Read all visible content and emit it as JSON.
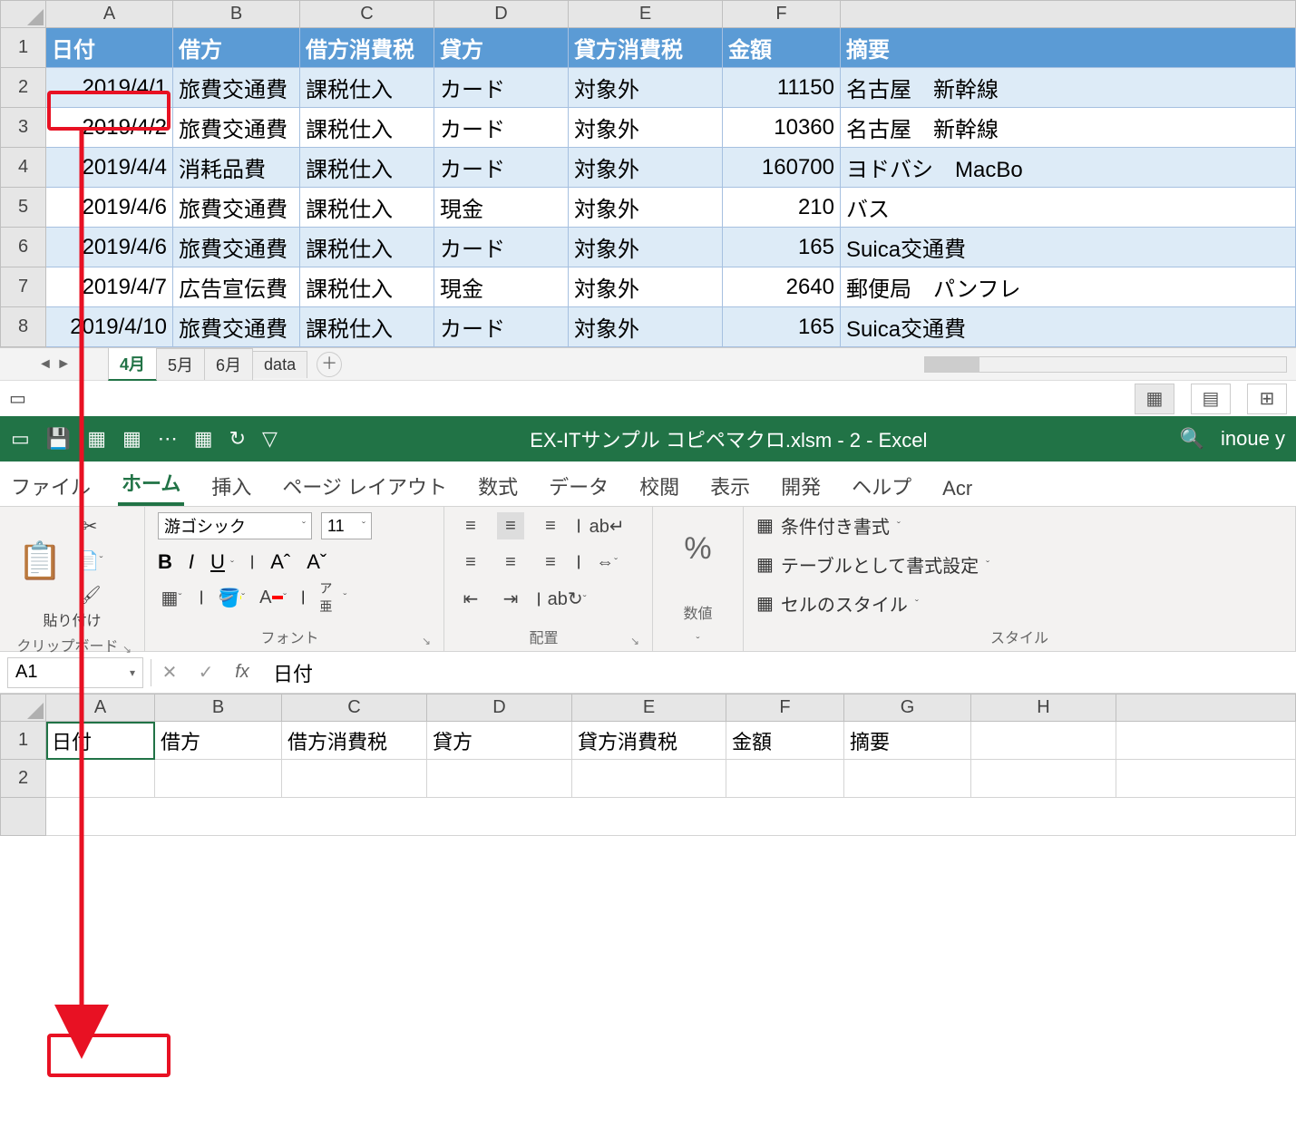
{
  "top_sheet": {
    "columns": [
      "A",
      "B",
      "C",
      "D",
      "E",
      "F",
      ""
    ],
    "headers": [
      "日付",
      "借方",
      "借方消費税",
      "貸方",
      "貸方消費税",
      "金額",
      "摘要"
    ],
    "rows": [
      {
        "n": 2,
        "date": "2019/4/1",
        "debit": "旅費交通費",
        "dtax": "課税仕入",
        "credit": "カード",
        "ctax": "対象外",
        "amount": "11150",
        "desc": "名古屋　新幹線"
      },
      {
        "n": 3,
        "date": "2019/4/2",
        "debit": "旅費交通費",
        "dtax": "課税仕入",
        "credit": "カード",
        "ctax": "対象外",
        "amount": "10360",
        "desc": "名古屋　新幹線"
      },
      {
        "n": 4,
        "date": "2019/4/4",
        "debit": "消耗品費",
        "dtax": "課税仕入",
        "credit": "カード",
        "ctax": "対象外",
        "amount": "160700",
        "desc": "ヨドバシ　MacBo"
      },
      {
        "n": 5,
        "date": "2019/4/6",
        "debit": "旅費交通費",
        "dtax": "課税仕入",
        "credit": "現金",
        "ctax": "対象外",
        "amount": "210",
        "desc": "バス"
      },
      {
        "n": 6,
        "date": "2019/4/6",
        "debit": "旅費交通費",
        "dtax": "課税仕入",
        "credit": "カード",
        "ctax": "対象外",
        "amount": "165",
        "desc": "Suica交通費"
      },
      {
        "n": 7,
        "date": "2019/4/7",
        "debit": "広告宣伝費",
        "dtax": "課税仕入",
        "credit": "現金",
        "ctax": "対象外",
        "amount": "2640",
        "desc": "郵便局　パンフレ"
      },
      {
        "n": 8,
        "date": "2019/4/10",
        "debit": "旅費交通費",
        "dtax": "課税仕入",
        "credit": "カード",
        "ctax": "対象外",
        "amount": "165",
        "desc": "Suica交通費"
      }
    ],
    "tabs": [
      "4月",
      "5月",
      "6月",
      "data"
    ]
  },
  "titlebar": {
    "title": "EX-ITサンプル コピペマクロ.xlsm - 2 - Excel",
    "user": "inoue y"
  },
  "ribbon": {
    "tabs": [
      "ファイル",
      "ホーム",
      "挿入",
      "ページ レイアウト",
      "数式",
      "データ",
      "校閲",
      "表示",
      "開発",
      "ヘルプ",
      "Acr"
    ],
    "clipboard": {
      "paste": "貼り付け",
      "label": "クリップボード"
    },
    "font": {
      "name": "游ゴシック",
      "size": "11",
      "bold": "B",
      "italic": "I",
      "underline": "U",
      "grow": "A",
      "shrink": "A",
      "ruby": "ア亜",
      "label": "フォント"
    },
    "align": {
      "wrap": "ab↵",
      "label": "配置"
    },
    "number": {
      "pct": "%",
      "label": "数値"
    },
    "styles": {
      "cond": "条件付き書式",
      "table": "テーブルとして書式設定",
      "cell": "セルのスタイル",
      "label": "スタイル"
    }
  },
  "formula_bar": {
    "ref": "A1",
    "value": "日付"
  },
  "bottom_sheet": {
    "columns": [
      "A",
      "B",
      "C",
      "D",
      "E",
      "F",
      "G",
      "H",
      ""
    ],
    "row1": [
      "日付",
      "借方",
      "借方消費税",
      "貸方",
      "貸方消費税",
      "金額",
      "摘要",
      "",
      ""
    ],
    "row2_n": "2"
  }
}
